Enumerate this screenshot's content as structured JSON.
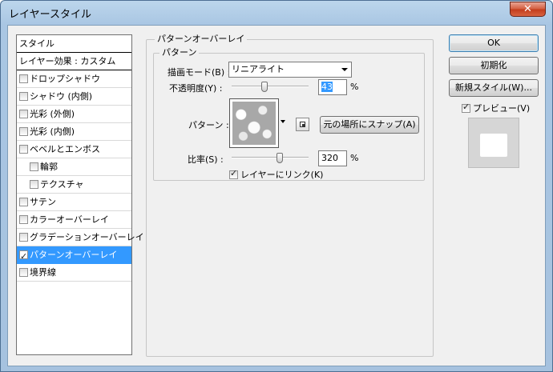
{
  "window": {
    "title": "レイヤースタイル",
    "close_glyph": "✕"
  },
  "style_list": {
    "header": "スタイル",
    "blend_options": "レイヤー効果 : カスタム",
    "items": [
      {
        "label": "ドロップシャドウ",
        "checked": false,
        "indent": false,
        "selected": false
      },
      {
        "label": "シャドウ (内側)",
        "checked": false,
        "indent": false,
        "selected": false
      },
      {
        "label": "光彩 (外側)",
        "checked": false,
        "indent": false,
        "selected": false
      },
      {
        "label": "光彩 (内側)",
        "checked": false,
        "indent": false,
        "selected": false
      },
      {
        "label": "ベベルとエンボス",
        "checked": false,
        "indent": false,
        "selected": false
      },
      {
        "label": "輪郭",
        "checked": false,
        "indent": true,
        "selected": false
      },
      {
        "label": "テクスチャ",
        "checked": false,
        "indent": true,
        "selected": false
      },
      {
        "label": "サテン",
        "checked": false,
        "indent": false,
        "selected": false
      },
      {
        "label": "カラーオーバーレイ",
        "checked": false,
        "indent": false,
        "selected": false
      },
      {
        "label": "グラデーションオーバーレイ",
        "checked": false,
        "indent": false,
        "selected": false
      },
      {
        "label": "パターンオーバーレイ",
        "checked": true,
        "indent": false,
        "selected": true
      },
      {
        "label": "境界線",
        "checked": false,
        "indent": false,
        "selected": false
      }
    ]
  },
  "pattern_overlay": {
    "group_title": "パターンオーバーレイ",
    "sub_group_title": "パターン",
    "blend_mode_label": "描画モード(B) :",
    "blend_mode_value": "リニアライト",
    "opacity_label": "不透明度(Y) :",
    "opacity_value": "43",
    "opacity_unit": "%",
    "opacity_fraction": 0.43,
    "pattern_label": "パターン :",
    "snap_button": "元の場所にスナップ(A)",
    "scale_label": "比率(S) :",
    "scale_value": "320",
    "scale_unit": "%",
    "link_label": "レイヤーにリンク(K)",
    "link_checked": true
  },
  "buttons": {
    "ok": "OK",
    "reset": "初期化",
    "new_style": "新規スタイル(W)...",
    "preview_label": "プレビュー(V)",
    "preview_checked": true
  }
}
